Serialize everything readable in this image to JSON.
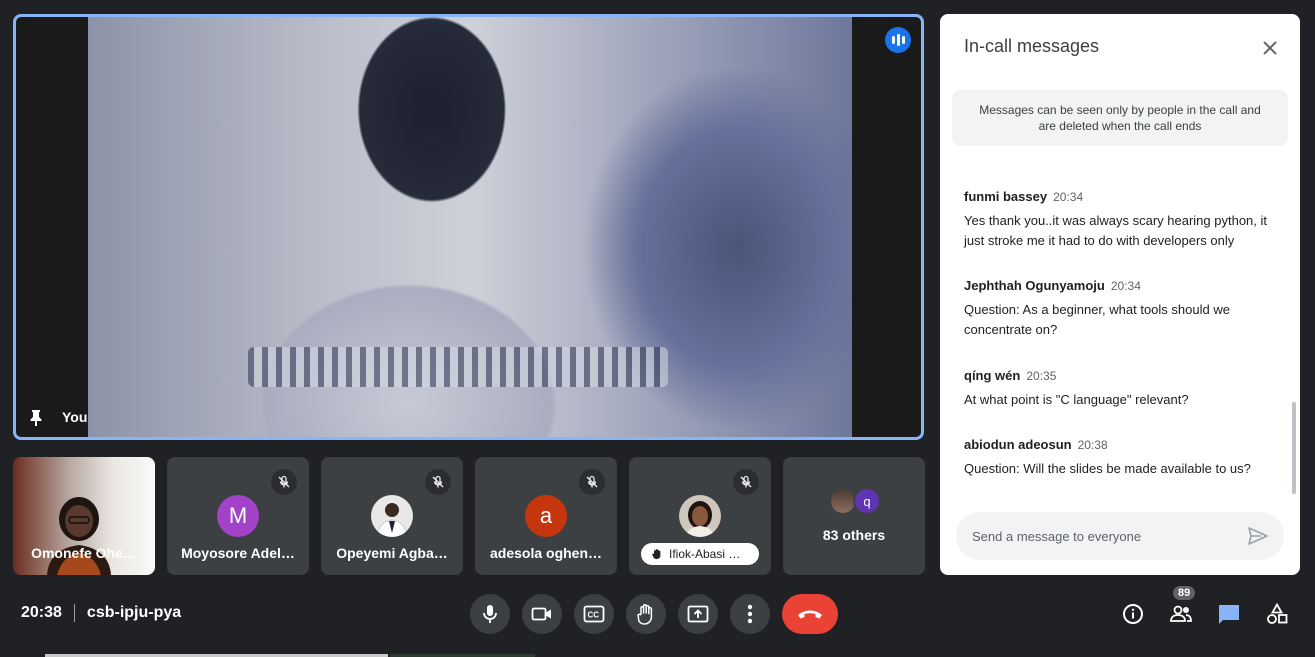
{
  "main_video": {
    "self_label": "You"
  },
  "participants": [
    {
      "name": "Omonefe Ohe…",
      "type": "camera"
    },
    {
      "name": "Moyosore Adel…",
      "initial": "M",
      "avatar_color": "#a142c8",
      "muted": true
    },
    {
      "name": "Opeyemi Agba…",
      "muted": true
    },
    {
      "name": "adesola oghen…",
      "initial": "a",
      "avatar_color": "#c5360f",
      "muted": true
    },
    {
      "name": "Ifiok-Abasi …",
      "muted": true,
      "hand_raised": true
    }
  ],
  "others": {
    "label": "83 others",
    "avatar_initial": "q"
  },
  "chat": {
    "title": "In-call messages",
    "notice": "Messages can be seen only by people in the call and are deleted when the call ends",
    "messages": [
      {
        "sender": "funmi bassey",
        "time": "20:34",
        "text": "Yes thank you..it was always scary hearing python, it just stroke me it had to do with developers only"
      },
      {
        "sender": "Jephthah Ogunyamoju",
        "time": "20:34",
        "text": "Question: As a beginner, what tools should we concentrate on?"
      },
      {
        "sender": "qíng wén",
        "time": "20:35",
        "text": "At what point is \"C language\" relevant?"
      },
      {
        "sender": "abiodun adeosun",
        "time": "20:38",
        "text": "Question: Will the slides be made available to us?"
      }
    ],
    "input_placeholder": "Send a message to everyone"
  },
  "bottom_bar": {
    "time": "20:38",
    "meeting_code": "csb-ipju-pya",
    "people_count": "89"
  },
  "colors": {
    "accent": "#8ab4f8",
    "end_call": "#ea4335",
    "chat_active": "#8ab4f8"
  }
}
